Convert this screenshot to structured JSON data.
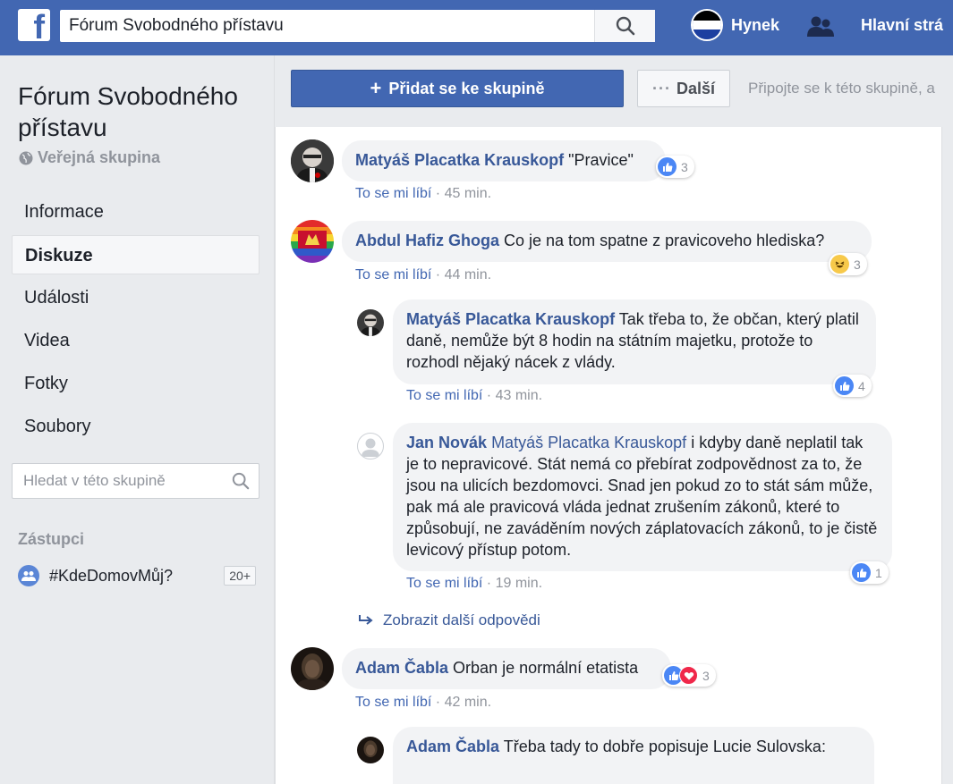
{
  "topbar": {
    "logo": "f",
    "search_value": "Fórum Svobodného přístavu",
    "user_name": "Hynek",
    "home_label": "Hlavní strá"
  },
  "sidebar": {
    "group_title": "Fórum Svobodného přístavu",
    "group_type": "Veřejná skupina",
    "nav": [
      {
        "label": "Informace",
        "active": false
      },
      {
        "label": "Diskuze",
        "active": true
      },
      {
        "label": "Události",
        "active": false
      },
      {
        "label": "Videa",
        "active": false
      },
      {
        "label": "Fotky",
        "active": false
      },
      {
        "label": "Soubory",
        "active": false
      }
    ],
    "search_placeholder": "Hledat v této skupině",
    "reps_heading": "Zástupci",
    "rep_name": "#KdeDomovMůj?",
    "rep_badge": "20+"
  },
  "actions": {
    "join_plus": "+",
    "join_label": "Přidat se ke skupině",
    "more_dots": "···",
    "more_label": "Další",
    "join_hint": "Připojte se k této skupině, a"
  },
  "comments": [
    {
      "author": "Matyáš Placatka Krauskopf",
      "text": "\"Pravice\"",
      "like": "To se mi líbí",
      "sep": " · ",
      "time": "45 min.",
      "reactions": "3"
    },
    {
      "author": "Abdul Hafiz Ghoga",
      "text": "Co je na tom spatne z pravicoveho hlediska?",
      "like": "To se mi líbí",
      "sep": " · ",
      "time": "44 min.",
      "reactions": "3"
    },
    {
      "author": "Matyáš Placatka Krauskopf",
      "text": "Tak třeba to, že občan, který platil daně, nemůže být 8 hodin na státním majetku, protože to rozhodl nějaký nácek z vlády.",
      "like": "To se mi líbí",
      "sep": " · ",
      "time": "43 min.",
      "reactions": "4"
    },
    {
      "author": "Jan Novák",
      "mention": "Matyáš Placatka Krauskopf",
      "text": "i kdyby daně neplatil tak je to nepravicové. Stát nemá co přebírat zodpovědnost za to, že jsou na ulicích bezdomovci. Snad jen pokud zo to stát sám může, pak má ale pravicová vláda jednat zrušením zákonů, které to způsobují, ne zaváděním nových záplatovacích zákonů, to je čistě levicový přístup potom.",
      "like": "To se mi líbí",
      "sep": " · ",
      "time": "19 min.",
      "reactions": "1"
    },
    {
      "author": "Adam Čabla",
      "text": "Orban je normální etatista",
      "like": "To se mi líbí",
      "sep": " · ",
      "time": "42 min.",
      "reactions": "3"
    },
    {
      "author": "Adam Čabla",
      "text": "Třeba tady to dobře popisuje Lucie Sulovska:"
    }
  ],
  "more_replies": "Zobrazit další odpovědi",
  "colors": {
    "brand": "#4267b2",
    "link": "#385898",
    "bubble": "#f2f3f5",
    "muted": "#90949c"
  }
}
